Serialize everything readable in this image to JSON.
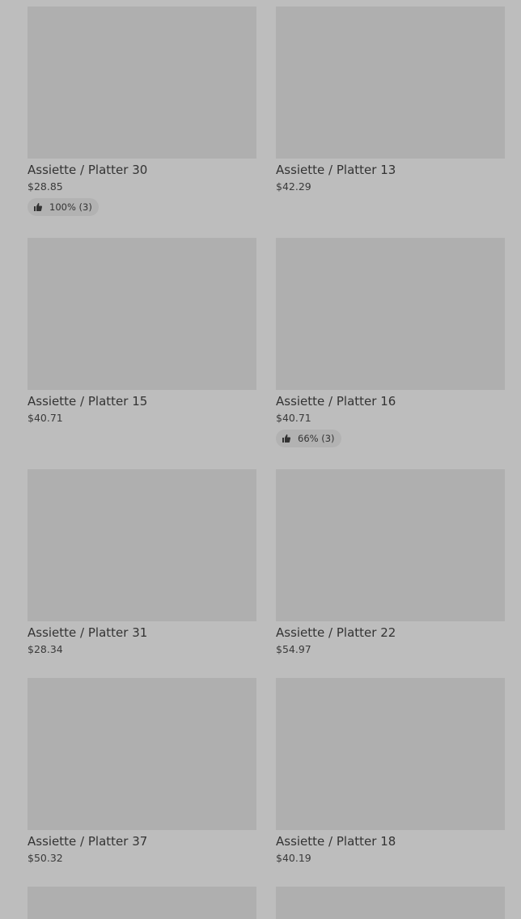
{
  "products": [
    {
      "title": "Assiette / Platter 30",
      "price": "$28.85",
      "rating": "100% (3)"
    },
    {
      "title": "Assiette / Platter 13",
      "price": "$42.29",
      "rating": null
    },
    {
      "title": "Assiette / Platter 15",
      "price": "$40.71",
      "rating": null
    },
    {
      "title": "Assiette / Platter 16",
      "price": "$40.71",
      "rating": "66% (3)"
    },
    {
      "title": "Assiette / Platter 31",
      "price": "$28.34",
      "rating": null
    },
    {
      "title": "Assiette / Platter 22",
      "price": "$54.97",
      "rating": null
    },
    {
      "title": "Assiette / Platter 37",
      "price": "$50.32",
      "rating": null
    },
    {
      "title": "Assiette / Platter 18",
      "price": "$40.19",
      "rating": null
    }
  ],
  "icons": {
    "rating_icon": "thumbs-up-icon"
  }
}
